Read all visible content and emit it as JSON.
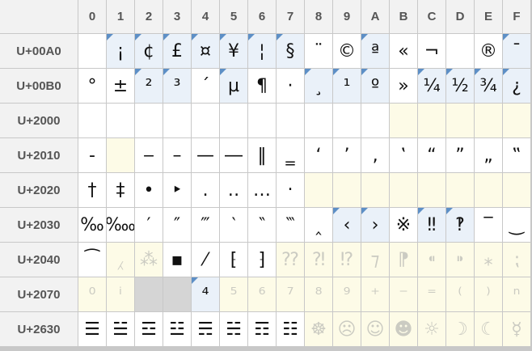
{
  "columns": [
    "0",
    "1",
    "2",
    "3",
    "4",
    "5",
    "6",
    "7",
    "8",
    "9",
    "A",
    "B",
    "C",
    "D",
    "E",
    "F"
  ],
  "rows": [
    {
      "label": "U+00A0",
      "cells": [
        {
          "ch": "",
          "bg": "n",
          "flag": false,
          "dim": false
        },
        {
          "ch": "¡",
          "bg": "b",
          "flag": true,
          "dim": false
        },
        {
          "ch": "¢",
          "bg": "b",
          "flag": true,
          "dim": false
        },
        {
          "ch": "£",
          "bg": "b",
          "flag": true,
          "dim": false
        },
        {
          "ch": "¤",
          "bg": "b",
          "flag": true,
          "dim": false
        },
        {
          "ch": "¥",
          "bg": "b",
          "flag": true,
          "dim": false
        },
        {
          "ch": "¦",
          "bg": "b",
          "flag": true,
          "dim": false
        },
        {
          "ch": "§",
          "bg": "b",
          "flag": true,
          "dim": false
        },
        {
          "ch": "¨",
          "bg": "n",
          "flag": false,
          "dim": false
        },
        {
          "ch": "©",
          "bg": "n",
          "flag": false,
          "dim": false
        },
        {
          "ch": "ª",
          "bg": "b",
          "flag": true,
          "dim": false
        },
        {
          "ch": "«",
          "bg": "n",
          "flag": false,
          "dim": false
        },
        {
          "ch": "¬",
          "bg": "n",
          "flag": false,
          "dim": false
        },
        {
          "ch": "",
          "bg": "n",
          "flag": false,
          "dim": false
        },
        {
          "ch": "®",
          "bg": "n",
          "flag": false,
          "dim": false
        },
        {
          "ch": "¯",
          "bg": "b",
          "flag": true,
          "dim": false
        }
      ]
    },
    {
      "label": "U+00B0",
      "cells": [
        {
          "ch": "°",
          "bg": "n",
          "flag": false,
          "dim": false
        },
        {
          "ch": "±",
          "bg": "n",
          "flag": false,
          "dim": false
        },
        {
          "ch": "²",
          "bg": "b",
          "flag": true,
          "dim": false
        },
        {
          "ch": "³",
          "bg": "b",
          "flag": true,
          "dim": false
        },
        {
          "ch": "´",
          "bg": "n",
          "flag": false,
          "dim": false
        },
        {
          "ch": "µ",
          "bg": "b",
          "flag": true,
          "dim": false
        },
        {
          "ch": "¶",
          "bg": "n",
          "flag": false,
          "dim": false
        },
        {
          "ch": "·",
          "bg": "n",
          "flag": false,
          "dim": false
        },
        {
          "ch": "¸",
          "bg": "b",
          "flag": true,
          "dim": false
        },
        {
          "ch": "¹",
          "bg": "b",
          "flag": true,
          "dim": false
        },
        {
          "ch": "º",
          "bg": "b",
          "flag": true,
          "dim": false
        },
        {
          "ch": "»",
          "bg": "n",
          "flag": false,
          "dim": false
        },
        {
          "ch": "¼",
          "bg": "b",
          "flag": true,
          "dim": false
        },
        {
          "ch": "½",
          "bg": "b",
          "flag": true,
          "dim": false
        },
        {
          "ch": "¾",
          "bg": "b",
          "flag": true,
          "dim": false
        },
        {
          "ch": "¿",
          "bg": "b",
          "flag": true,
          "dim": false
        }
      ]
    },
    {
      "label": "U+2000",
      "cells": [
        {
          "ch": "",
          "bg": "n",
          "flag": false,
          "dim": false
        },
        {
          "ch": "",
          "bg": "n",
          "flag": false,
          "dim": false
        },
        {
          "ch": "",
          "bg": "n",
          "flag": false,
          "dim": false
        },
        {
          "ch": "",
          "bg": "n",
          "flag": false,
          "dim": false
        },
        {
          "ch": "",
          "bg": "n",
          "flag": false,
          "dim": false
        },
        {
          "ch": "",
          "bg": "n",
          "flag": false,
          "dim": false
        },
        {
          "ch": "",
          "bg": "n",
          "flag": false,
          "dim": false
        },
        {
          "ch": "",
          "bg": "n",
          "flag": false,
          "dim": false
        },
        {
          "ch": "",
          "bg": "n",
          "flag": false,
          "dim": false
        },
        {
          "ch": "",
          "bg": "n",
          "flag": false,
          "dim": false
        },
        {
          "ch": "",
          "bg": "n",
          "flag": false,
          "dim": false
        },
        {
          "ch": "",
          "bg": "y",
          "flag": false,
          "dim": false
        },
        {
          "ch": "",
          "bg": "y",
          "flag": false,
          "dim": false
        },
        {
          "ch": "",
          "bg": "y",
          "flag": false,
          "dim": false
        },
        {
          "ch": "",
          "bg": "y",
          "flag": false,
          "dim": false
        },
        {
          "ch": "",
          "bg": "y",
          "flag": false,
          "dim": false
        }
      ]
    },
    {
      "label": "U+2010",
      "cells": [
        {
          "ch": "‐",
          "bg": "n",
          "flag": false,
          "dim": false
        },
        {
          "ch": "",
          "bg": "y",
          "flag": false,
          "dim": false
        },
        {
          "ch": "‒",
          "bg": "n",
          "flag": false,
          "dim": false
        },
        {
          "ch": "–",
          "bg": "n",
          "flag": false,
          "dim": false
        },
        {
          "ch": "—",
          "bg": "n",
          "flag": false,
          "dim": false
        },
        {
          "ch": "―",
          "bg": "n",
          "flag": false,
          "dim": false
        },
        {
          "ch": "‖",
          "bg": "n",
          "flag": false,
          "dim": false
        },
        {
          "ch": "‗",
          "bg": "n",
          "flag": false,
          "dim": false
        },
        {
          "ch": "‘",
          "bg": "n",
          "flag": false,
          "dim": false
        },
        {
          "ch": "’",
          "bg": "n",
          "flag": false,
          "dim": false
        },
        {
          "ch": "‚",
          "bg": "n",
          "flag": false,
          "dim": false
        },
        {
          "ch": "‛",
          "bg": "n",
          "flag": false,
          "dim": false
        },
        {
          "ch": "“",
          "bg": "n",
          "flag": false,
          "dim": false
        },
        {
          "ch": "”",
          "bg": "n",
          "flag": false,
          "dim": false
        },
        {
          "ch": "„",
          "bg": "n",
          "flag": false,
          "dim": false
        },
        {
          "ch": "‟",
          "bg": "n",
          "flag": false,
          "dim": false
        }
      ]
    },
    {
      "label": "U+2020",
      "cells": [
        {
          "ch": "†",
          "bg": "n",
          "flag": false,
          "dim": false
        },
        {
          "ch": "‡",
          "bg": "n",
          "flag": false,
          "dim": false
        },
        {
          "ch": "•",
          "bg": "n",
          "flag": false,
          "dim": false
        },
        {
          "ch": "‣",
          "bg": "n",
          "flag": false,
          "dim": false
        },
        {
          "ch": "․",
          "bg": "n",
          "flag": false,
          "dim": false
        },
        {
          "ch": "‥",
          "bg": "n",
          "flag": false,
          "dim": false
        },
        {
          "ch": "…",
          "bg": "n",
          "flag": false,
          "dim": false
        },
        {
          "ch": "‧",
          "bg": "n",
          "flag": false,
          "dim": false
        },
        {
          "ch": "",
          "bg": "y",
          "flag": false,
          "dim": false
        },
        {
          "ch": "",
          "bg": "y",
          "flag": false,
          "dim": false
        },
        {
          "ch": "",
          "bg": "y",
          "flag": false,
          "dim": false
        },
        {
          "ch": "",
          "bg": "y",
          "flag": false,
          "dim": false
        },
        {
          "ch": "",
          "bg": "y",
          "flag": false,
          "dim": false
        },
        {
          "ch": "",
          "bg": "y",
          "flag": false,
          "dim": false
        },
        {
          "ch": "",
          "bg": "y",
          "flag": false,
          "dim": false
        },
        {
          "ch": "",
          "bg": "y",
          "flag": false,
          "dim": false
        }
      ]
    },
    {
      "label": "U+2030",
      "cells": [
        {
          "ch": "‰",
          "bg": "n",
          "flag": false,
          "dim": false
        },
        {
          "ch": "‱",
          "bg": "n",
          "flag": false,
          "dim": false
        },
        {
          "ch": "′",
          "bg": "n",
          "flag": false,
          "dim": false
        },
        {
          "ch": "″",
          "bg": "n",
          "flag": false,
          "dim": false
        },
        {
          "ch": "‴",
          "bg": "n",
          "flag": false,
          "dim": false
        },
        {
          "ch": "‵",
          "bg": "n",
          "flag": false,
          "dim": false
        },
        {
          "ch": "‶",
          "bg": "n",
          "flag": false,
          "dim": false
        },
        {
          "ch": "‷",
          "bg": "n",
          "flag": false,
          "dim": false
        },
        {
          "ch": "‸",
          "bg": "n",
          "flag": false,
          "dim": false
        },
        {
          "ch": "‹",
          "bg": "b",
          "flag": true,
          "dim": false
        },
        {
          "ch": "›",
          "bg": "b",
          "flag": true,
          "dim": false
        },
        {
          "ch": "※",
          "bg": "n",
          "flag": false,
          "dim": false
        },
        {
          "ch": "‼",
          "bg": "b",
          "flag": true,
          "dim": false
        },
        {
          "ch": "‽",
          "bg": "b",
          "flag": true,
          "dim": false
        },
        {
          "ch": "‾",
          "bg": "n",
          "flag": false,
          "dim": false
        },
        {
          "ch": "‿",
          "bg": "n",
          "flag": false,
          "dim": false
        }
      ]
    },
    {
      "label": "U+2040",
      "cells": [
        {
          "ch": "⁀",
          "bg": "n",
          "flag": false,
          "dim": false
        },
        {
          "ch": "⁁",
          "bg": "y",
          "flag": false,
          "dim": true
        },
        {
          "ch": "⁂",
          "bg": "y",
          "flag": false,
          "dim": true
        },
        {
          "ch": "▪",
          "bg": "n",
          "flag": false,
          "dim": false
        },
        {
          "ch": "⁄",
          "bg": "n",
          "flag": false,
          "dim": false
        },
        {
          "ch": "⁅",
          "bg": "n",
          "flag": false,
          "dim": false
        },
        {
          "ch": "⁆",
          "bg": "n",
          "flag": false,
          "dim": false
        },
        {
          "ch": "⁇",
          "bg": "y",
          "flag": false,
          "dim": true
        },
        {
          "ch": "⁈",
          "bg": "y",
          "flag": false,
          "dim": true
        },
        {
          "ch": "⁉",
          "bg": "y",
          "flag": false,
          "dim": true
        },
        {
          "ch": "⁊",
          "bg": "y",
          "flag": false,
          "dim": true
        },
        {
          "ch": "⁋",
          "bg": "y",
          "flag": false,
          "dim": true
        },
        {
          "ch": "⁌",
          "bg": "y",
          "flag": false,
          "dim": true
        },
        {
          "ch": "⁍",
          "bg": "y",
          "flag": false,
          "dim": true
        },
        {
          "ch": "⁎",
          "bg": "y",
          "flag": false,
          "dim": true
        },
        {
          "ch": "⁏",
          "bg": "y",
          "flag": false,
          "dim": true
        }
      ]
    },
    {
      "label": "U+2070",
      "cells": [
        {
          "ch": "⁰",
          "bg": "y",
          "flag": false,
          "dim": true
        },
        {
          "ch": "ⁱ",
          "bg": "y",
          "flag": false,
          "dim": true
        },
        {
          "ch": "",
          "bg": "g",
          "flag": false,
          "dim": false
        },
        {
          "ch": "",
          "bg": "g",
          "flag": false,
          "dim": false
        },
        {
          "ch": "⁴",
          "bg": "b",
          "flag": true,
          "dim": false
        },
        {
          "ch": "⁵",
          "bg": "y",
          "flag": false,
          "dim": true
        },
        {
          "ch": "⁶",
          "bg": "y",
          "flag": false,
          "dim": true
        },
        {
          "ch": "⁷",
          "bg": "y",
          "flag": false,
          "dim": true
        },
        {
          "ch": "⁸",
          "bg": "y",
          "flag": false,
          "dim": true
        },
        {
          "ch": "⁹",
          "bg": "y",
          "flag": false,
          "dim": true
        },
        {
          "ch": "⁺",
          "bg": "y",
          "flag": false,
          "dim": true
        },
        {
          "ch": "⁻",
          "bg": "y",
          "flag": false,
          "dim": true
        },
        {
          "ch": "⁼",
          "bg": "y",
          "flag": false,
          "dim": true
        },
        {
          "ch": "⁽",
          "bg": "y",
          "flag": false,
          "dim": true
        },
        {
          "ch": "⁾",
          "bg": "y",
          "flag": false,
          "dim": true
        },
        {
          "ch": "ⁿ",
          "bg": "y",
          "flag": false,
          "dim": true
        }
      ]
    },
    {
      "label": "U+2630",
      "cells": [
        {
          "ch": "☰",
          "bg": "n",
          "flag": false,
          "dim": false
        },
        {
          "ch": "☱",
          "bg": "n",
          "flag": false,
          "dim": false
        },
        {
          "ch": "☲",
          "bg": "n",
          "flag": false,
          "dim": false
        },
        {
          "ch": "☳",
          "bg": "n",
          "flag": false,
          "dim": false
        },
        {
          "ch": "☴",
          "bg": "n",
          "flag": false,
          "dim": false
        },
        {
          "ch": "☵",
          "bg": "n",
          "flag": false,
          "dim": false
        },
        {
          "ch": "☶",
          "bg": "n",
          "flag": false,
          "dim": false
        },
        {
          "ch": "☷",
          "bg": "n",
          "flag": false,
          "dim": false
        },
        {
          "ch": "☸",
          "bg": "y",
          "flag": false,
          "dim": true
        },
        {
          "ch": "☹",
          "bg": "y",
          "flag": false,
          "dim": true
        },
        {
          "ch": "☺",
          "bg": "y",
          "flag": false,
          "dim": true
        },
        {
          "ch": "☻",
          "bg": "y",
          "flag": false,
          "dim": true
        },
        {
          "ch": "☼",
          "bg": "y",
          "flag": false,
          "dim": true
        },
        {
          "ch": "☽",
          "bg": "y",
          "flag": false,
          "dim": true
        },
        {
          "ch": "☾",
          "bg": "y",
          "flag": false,
          "dim": true
        },
        {
          "ch": "☿",
          "bg": "y",
          "flag": false,
          "dim": true
        }
      ]
    }
  ]
}
